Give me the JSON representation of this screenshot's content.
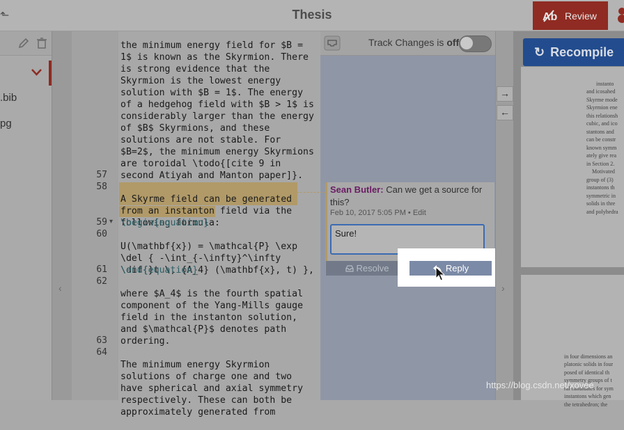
{
  "header": {
    "title": "Thesis",
    "review_label": "Review"
  },
  "filetree": {
    "items": [
      ".bib",
      "pg"
    ]
  },
  "editor": {
    "code_top": [
      "the minimum energy field for $B =",
      "1$ is known as the Skyrmion. There",
      "is strong evidence that the",
      "Skyrmion is the lowest energy",
      "solution with $B = 1$. The energy",
      "of a hedgehog field with $B > 1$ is",
      "considerably larger than the energy",
      "of $B$ Skyrmions, and these",
      "solutions are not stable. For",
      "$B=2$, the minimum energy Skyrmions",
      "are toroidal \\todo{[cite 9 in",
      "second Atiyah and Manton paper]}."
    ],
    "line_numbers": [
      "57",
      "58",
      "59",
      "60",
      "61",
      "62",
      "63",
      "64"
    ],
    "line58": [
      "A Skyrme field can be generated",
      "from an instanton field via the",
      "following formula:"
    ],
    "line59": "\\begin{equation}",
    "line60": [
      "U(\\mathbf{x}) = \\mathcal{P} \\exp",
      "\\del { -\\int_{-\\infty}^\\infty",
      "\\dif{}t \\, {A_4} (\\mathbf{x}, t) },"
    ],
    "line61": "\\end{equation}",
    "line62": [
      "where $A_4$ is the fourth spatial",
      "component of the Yang-Mills gauge",
      "field in the instanton solution,",
      "and $\\mathcal{P}$ denotes path",
      "ordering."
    ],
    "line64": [
      "The minimum energy Skyrmion",
      "solutions of charge one and two",
      "have spherical and axial symmetry",
      "respectively. These can both be",
      "approximately generated from"
    ]
  },
  "review": {
    "track_changes_label": "Track Changes is",
    "track_changes_state": "off",
    "comment": {
      "author": "Sean Butler:",
      "text": "Can we get a source for this?",
      "date": "Feb 10, 2017 5:05 PM",
      "edit_label": "Edit",
      "reply_value": "Sure!",
      "resolve_label": "Resolve",
      "reply_label": "Reply"
    }
  },
  "pdf": {
    "recompile_label": "Recompile",
    "page1": [
      "instanto",
      "and icosahed",
      "Skyrme mode",
      "Skyrmion ene",
      "this relationsh",
      "cubic, and ico",
      "stantons and",
      "can be constr",
      "known symm",
      "ately give rea",
      "in Section 2.",
      "    Motivated",
      "group of (3)",
      "instantons th",
      "symmetric in",
      "solids in thre",
      "and polyhedra"
    ],
    "page2": [
      "in four dimensions an",
      "platonic solids in four",
      "posed of identical th",
      "symmetry groups of t",
      "ral candidates for sym",
      "instantons which gen",
      "the tetrahedron; the"
    ]
  },
  "watermark": "https://blog.csdn.net/xovee"
}
